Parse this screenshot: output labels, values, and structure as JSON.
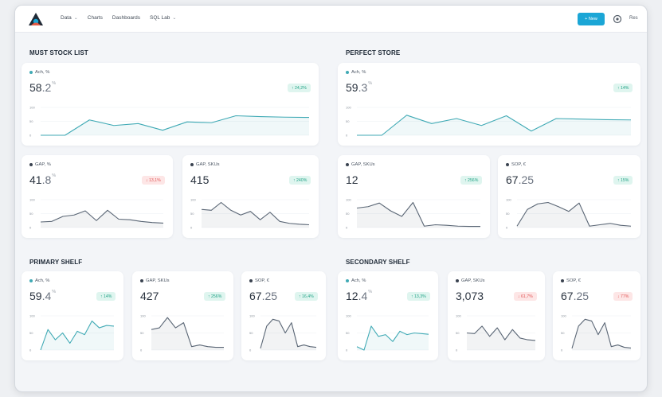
{
  "nav": {
    "menu": [
      {
        "label": "Data",
        "dropdown": true
      },
      {
        "label": "Charts",
        "dropdown": false
      },
      {
        "label": "Dashboards",
        "dropdown": false
      },
      {
        "label": "SQL Lab",
        "dropdown": true
      }
    ],
    "new_button": "+ New",
    "user_label": "Res"
  },
  "sections": [
    {
      "title": "MUST STOCK LIST"
    },
    {
      "title": "PERFECT STORE"
    },
    {
      "title": "PRIMARY SHELF"
    },
    {
      "title": "SECONDARY SHELF"
    }
  ],
  "colors": {
    "teal": "#40aab5",
    "gray_line": "#596574",
    "up_text": "#21a386",
    "down_text": "#e25656",
    "accent": "#1ba6d6"
  },
  "cards": [
    {
      "label": "Ach, %",
      "dot": "teal",
      "int": "58",
      "dec": ".2",
      "unit": "%",
      "badge": "↑ 24,2%",
      "trend": "up",
      "series": [
        0,
        0,
        55,
        35,
        42,
        18,
        48,
        45,
        70,
        67,
        65,
        64
      ],
      "line": "teal"
    },
    {
      "label": "GAP, %",
      "dot": "gray",
      "int": "41",
      "dec": ".8",
      "unit": "%",
      "badge": "↓ 13,1%",
      "trend": "down",
      "series": [
        20,
        22,
        40,
        45,
        60,
        25,
        62,
        30,
        28,
        22,
        18,
        16
      ],
      "line": "gray"
    },
    {
      "label": "GAP, SKUs",
      "dot": "gray",
      "int": "415",
      "dec": "",
      "unit": "",
      "badge": "↑ 240%",
      "trend": "up",
      "series": [
        65,
        62,
        90,
        62,
        45,
        58,
        28,
        55,
        22,
        15,
        12,
        10
      ],
      "line": "gray"
    },
    {
      "label": "Ach, %",
      "dot": "teal",
      "int": "59",
      "dec": ".3",
      "unit": "%",
      "badge": "↑ 14%",
      "trend": "up",
      "series": [
        0,
        0,
        72,
        42,
        60,
        35,
        70,
        15,
        60,
        58,
        56,
        55
      ],
      "line": "teal"
    },
    {
      "label": "GAP, SKUs",
      "dot": "gray",
      "int": "12",
      "dec": "",
      "unit": "",
      "badge": "↑ 256%",
      "trend": "up",
      "series": [
        70,
        75,
        88,
        60,
        40,
        90,
        5,
        10,
        8,
        5,
        4,
        4
      ],
      "line": "gray"
    },
    {
      "label": "SOP, €",
      "dot": "gray",
      "int": "67",
      "dec": ".25",
      "unit": "",
      "badge": "↑ 15%",
      "trend": "up",
      "series": [
        5,
        65,
        85,
        90,
        75,
        58,
        88,
        5,
        10,
        15,
        8,
        5
      ],
      "line": "gray"
    },
    {
      "label": "Ach, %",
      "dot": "teal",
      "int": "59",
      "dec": ".4",
      "unit": "%",
      "badge": "↑ 14%",
      "trend": "up",
      "series": [
        0,
        60,
        30,
        50,
        20,
        55,
        45,
        85,
        65,
        72,
        70
      ],
      "line": "teal"
    },
    {
      "label": "GAP, SKUs",
      "dot": "gray",
      "int": "427",
      "dec": "",
      "unit": "",
      "badge": "↑ 256%",
      "trend": "up",
      "series": [
        60,
        65,
        95,
        65,
        80,
        10,
        15,
        10,
        8,
        8
      ],
      "line": "gray"
    },
    {
      "label": "SOP, €",
      "dot": "gray",
      "int": "67",
      "dec": ".25",
      "unit": "",
      "badge": "↑ 16,4%",
      "trend": "up",
      "series": [
        5,
        70,
        90,
        85,
        50,
        80,
        10,
        15,
        10,
        8
      ],
      "line": "gray"
    },
    {
      "label": "Ach, %",
      "dot": "teal",
      "int": "12",
      "dec": ".4",
      "unit": "%",
      "badge": "↑ 13,3%",
      "trend": "up",
      "series": [
        10,
        0,
        70,
        40,
        45,
        25,
        55,
        45,
        50,
        48,
        46
      ],
      "line": "teal"
    },
    {
      "label": "GAP, SKUs",
      "dot": "gray",
      "int": "3,073",
      "dec": "",
      "unit": "",
      "badge": "↓ 61,7%",
      "trend": "down",
      "series": [
        50,
        48,
        70,
        40,
        65,
        30,
        60,
        35,
        30,
        28
      ],
      "line": "gray"
    },
    {
      "label": "SOP, €",
      "dot": "gray",
      "int": "67",
      "dec": ".25",
      "unit": "",
      "badge": "↓ 77%",
      "trend": "down",
      "series": [
        5,
        70,
        90,
        85,
        45,
        80,
        10,
        15,
        8,
        6
      ],
      "line": "gray"
    }
  ],
  "chart_axis": {
    "ticks": [
      "100",
      "50",
      "0"
    ]
  }
}
